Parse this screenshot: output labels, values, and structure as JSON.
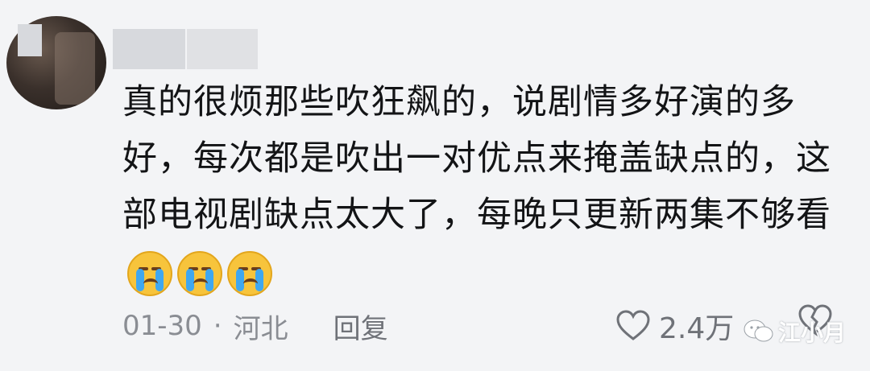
{
  "comment": {
    "text": "真的很烦那些吹狂飙的，说剧情多好演的多好，每次都是吹出一对优点来掩盖缺点的，这部电视剧缺点太大了，每晚只更新两集不够看",
    "emojis": [
      "cry-emoji",
      "cry-emoji",
      "cry-emoji"
    ]
  },
  "meta": {
    "date": "01-30",
    "separator": "·",
    "location": "河北",
    "reply_label": "回复"
  },
  "actions": {
    "like_count": "2.4万",
    "like_icon": "heart-outline-icon",
    "dislike_icon": "broken-heart-icon"
  },
  "watermark": {
    "text": "江小月",
    "icon": "wechat-icon"
  },
  "colors": {
    "background": "#f3f4f6",
    "text": "#131416",
    "meta": "#8a8d93"
  }
}
